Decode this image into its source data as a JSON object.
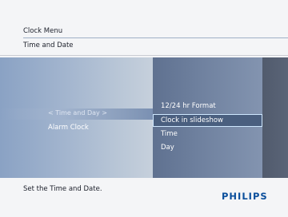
{
  "header": {
    "menu_title": "Clock Menu",
    "submenu_title": "Time and Date"
  },
  "menu": {
    "left_items": [
      {
        "label": "< Time and Day >",
        "selected": true
      },
      {
        "label": "Alarm Clock",
        "selected": false
      }
    ],
    "options": [
      {
        "label": "12/24 hr Format",
        "selected": false
      },
      {
        "label": "Clock in slideshow",
        "selected": true
      },
      {
        "label": "Time",
        "selected": false
      },
      {
        "label": "Day",
        "selected": false
      }
    ]
  },
  "footer": {
    "help_text": "Set the Time and Date.",
    "brand": "PHILIPS"
  },
  "colors": {
    "brand_blue": "#0b4f9c",
    "selection_border": "#cfe8ff"
  }
}
